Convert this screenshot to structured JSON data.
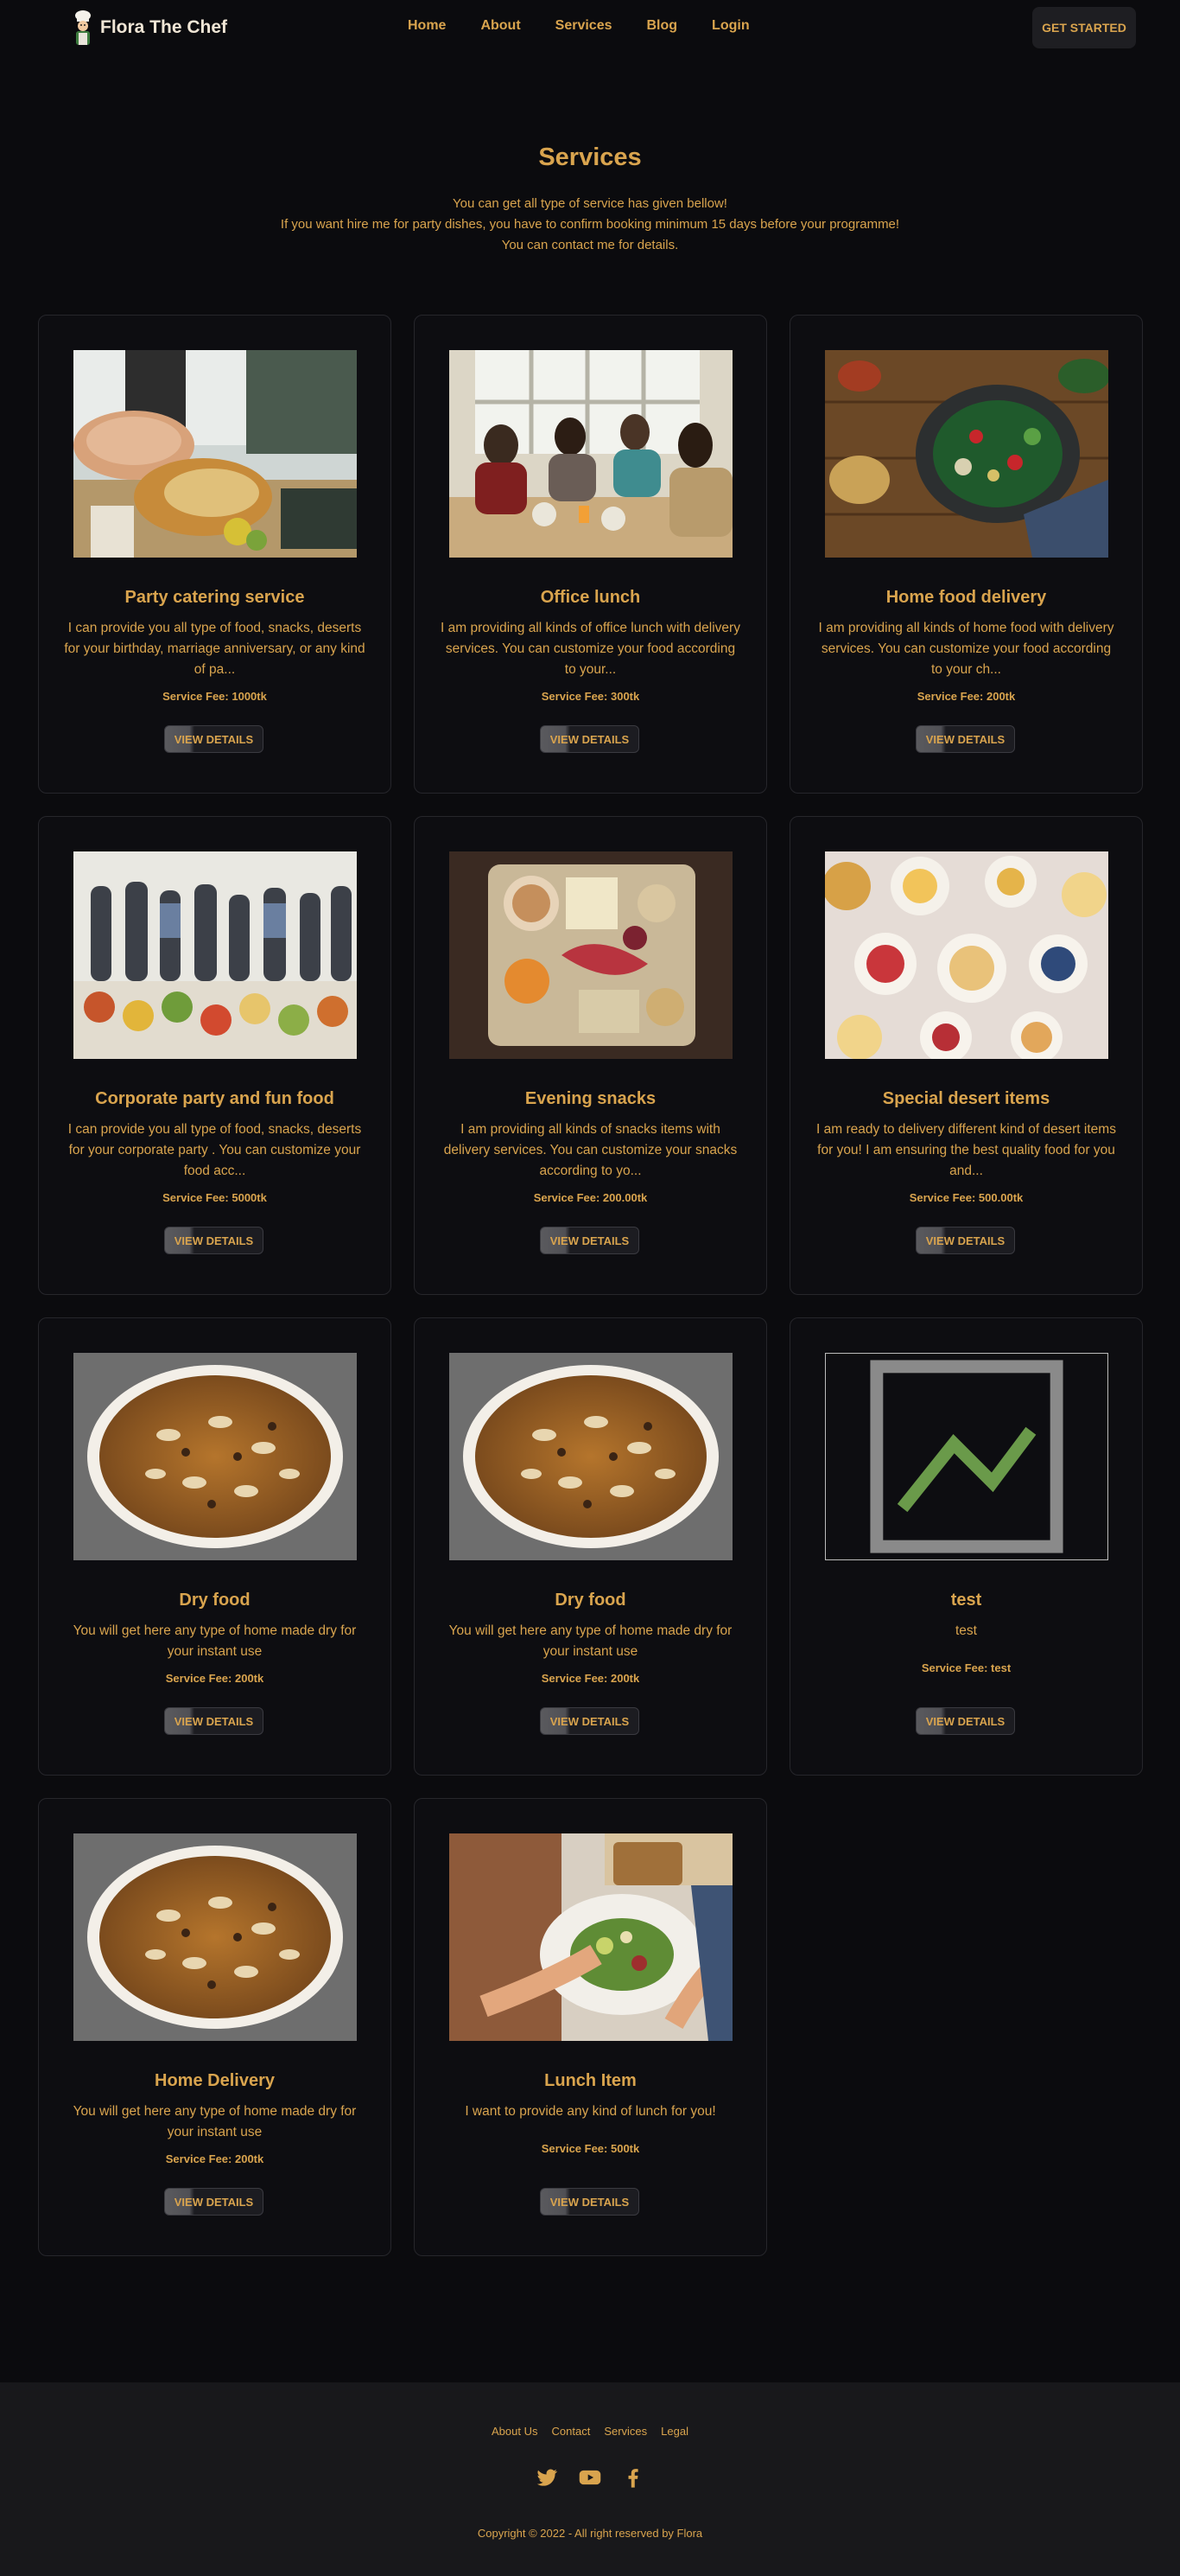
{
  "brand": {
    "name": "Flora The Chef",
    "accent": "#d9a44e"
  },
  "nav": {
    "links": [
      "Home",
      "About",
      "Services",
      "Blog",
      "Login"
    ],
    "cta": "GET STARTED"
  },
  "hero": {
    "title": "Services",
    "lines": [
      "You can get all type of service has given bellow!",
      "If you want hire me for party dishes, you have to confirm booking minimum 15 days before your programme!",
      "You can contact me for details."
    ]
  },
  "services": [
    {
      "title": "Party catering service",
      "desc": "I can provide you all type of food, snacks, deserts for your birthday, marriage anniversary, or any kind of pa...",
      "fee": "Service Fee: 1000tk",
      "button": "VIEW DETAILS",
      "image": "catering-buffet"
    },
    {
      "title": "Office lunch",
      "desc": "I am providing all kinds of office lunch with delivery services. You can customize your food according to your...",
      "fee": "Service Fee: 300tk",
      "button": "VIEW DETAILS",
      "image": "office-people"
    },
    {
      "title": "Home food delivery",
      "desc": "I am providing all kinds of home food with delivery services. You can customize your food according to your ch...",
      "fee": "Service Fee: 200tk",
      "button": "VIEW DETAILS",
      "image": "salad-bowl"
    },
    {
      "title": "Corporate party and fun food",
      "desc": "I can provide you all type of food, snacks, deserts for your corporate party . You can customize your food acc...",
      "fee": "Service Fee: 5000tk",
      "button": "VIEW DETAILS",
      "image": "party-crowd"
    },
    {
      "title": "Evening snacks",
      "desc": "I am providing all kinds of snacks items with delivery services. You can customize your snacks according to yo...",
      "fee": "Service Fee: 200.00tk",
      "button": "VIEW DETAILS",
      "image": "snack-platter"
    },
    {
      "title": "Special desert items",
      "desc": "I am ready to delivery different kind of desert items for you! I am ensuring the best quality food for you and...",
      "fee": "Service Fee: 500.00tk",
      "button": "VIEW DETAILS",
      "image": "dessert-table"
    },
    {
      "title": "Dry food",
      "desc": "You will get here any type of home made dry for your instant use",
      "fee": "Service Fee: 200tk",
      "button": "VIEW DETAILS",
      "image": "dry-food-bowl"
    },
    {
      "title": "Dry food",
      "desc": "You will get here any type of home made dry for your instant use",
      "fee": "Service Fee: 200tk",
      "button": "VIEW DETAILS",
      "image": "dry-food-bowl"
    },
    {
      "title": "test",
      "desc": "test",
      "fee": "Service Fee: test",
      "button": "VIEW DETAILS",
      "image": "broken-image"
    },
    {
      "title": "Home Delivery",
      "desc": "You will get here any type of home made dry for your instant use",
      "fee": "Service Fee: 200tk",
      "button": "VIEW DETAILS",
      "image": "dry-food-bowl"
    },
    {
      "title": "Lunch Item",
      "desc": "I want to provide any kind of lunch for you!",
      "fee": "Service Fee: 500tk",
      "button": "VIEW DETAILS",
      "image": "lunch-plate"
    }
  ],
  "footer": {
    "links": [
      "About Us",
      "Contact",
      "Services",
      "Legal"
    ],
    "social": [
      "twitter-icon",
      "youtube-icon",
      "facebook-icon"
    ],
    "copyright": "Copyright © 2022 - All right reserved by Flora"
  }
}
